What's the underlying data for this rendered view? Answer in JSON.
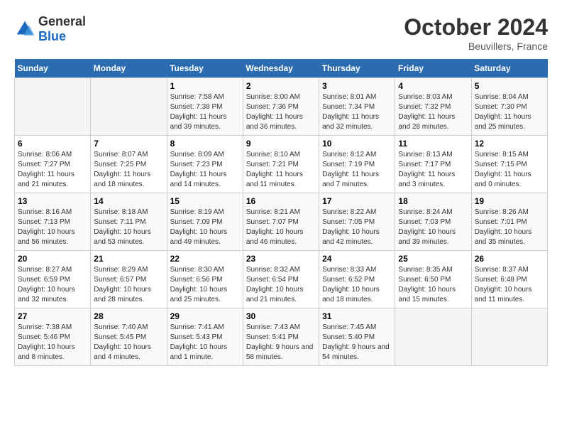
{
  "header": {
    "logo_general": "General",
    "logo_blue": "Blue",
    "month_year": "October 2024",
    "location": "Beuvillers, France"
  },
  "days_of_week": [
    "Sunday",
    "Monday",
    "Tuesday",
    "Wednesday",
    "Thursday",
    "Friday",
    "Saturday"
  ],
  "weeks": [
    [
      {
        "day": "",
        "sunrise": "",
        "sunset": "",
        "daylight": ""
      },
      {
        "day": "",
        "sunrise": "",
        "sunset": "",
        "daylight": ""
      },
      {
        "day": "1",
        "sunrise": "Sunrise: 7:58 AM",
        "sunset": "Sunset: 7:38 PM",
        "daylight": "Daylight: 11 hours and 39 minutes."
      },
      {
        "day": "2",
        "sunrise": "Sunrise: 8:00 AM",
        "sunset": "Sunset: 7:36 PM",
        "daylight": "Daylight: 11 hours and 36 minutes."
      },
      {
        "day": "3",
        "sunrise": "Sunrise: 8:01 AM",
        "sunset": "Sunset: 7:34 PM",
        "daylight": "Daylight: 11 hours and 32 minutes."
      },
      {
        "day": "4",
        "sunrise": "Sunrise: 8:03 AM",
        "sunset": "Sunset: 7:32 PM",
        "daylight": "Daylight: 11 hours and 28 minutes."
      },
      {
        "day": "5",
        "sunrise": "Sunrise: 8:04 AM",
        "sunset": "Sunset: 7:30 PM",
        "daylight": "Daylight: 11 hours and 25 minutes."
      }
    ],
    [
      {
        "day": "6",
        "sunrise": "Sunrise: 8:06 AM",
        "sunset": "Sunset: 7:27 PM",
        "daylight": "Daylight: 11 hours and 21 minutes."
      },
      {
        "day": "7",
        "sunrise": "Sunrise: 8:07 AM",
        "sunset": "Sunset: 7:25 PM",
        "daylight": "Daylight: 11 hours and 18 minutes."
      },
      {
        "day": "8",
        "sunrise": "Sunrise: 8:09 AM",
        "sunset": "Sunset: 7:23 PM",
        "daylight": "Daylight: 11 hours and 14 minutes."
      },
      {
        "day": "9",
        "sunrise": "Sunrise: 8:10 AM",
        "sunset": "Sunset: 7:21 PM",
        "daylight": "Daylight: 11 hours and 11 minutes."
      },
      {
        "day": "10",
        "sunrise": "Sunrise: 8:12 AM",
        "sunset": "Sunset: 7:19 PM",
        "daylight": "Daylight: 11 hours and 7 minutes."
      },
      {
        "day": "11",
        "sunrise": "Sunrise: 8:13 AM",
        "sunset": "Sunset: 7:17 PM",
        "daylight": "Daylight: 11 hours and 3 minutes."
      },
      {
        "day": "12",
        "sunrise": "Sunrise: 8:15 AM",
        "sunset": "Sunset: 7:15 PM",
        "daylight": "Daylight: 11 hours and 0 minutes."
      }
    ],
    [
      {
        "day": "13",
        "sunrise": "Sunrise: 8:16 AM",
        "sunset": "Sunset: 7:13 PM",
        "daylight": "Daylight: 10 hours and 56 minutes."
      },
      {
        "day": "14",
        "sunrise": "Sunrise: 8:18 AM",
        "sunset": "Sunset: 7:11 PM",
        "daylight": "Daylight: 10 hours and 53 minutes."
      },
      {
        "day": "15",
        "sunrise": "Sunrise: 8:19 AM",
        "sunset": "Sunset: 7:09 PM",
        "daylight": "Daylight: 10 hours and 49 minutes."
      },
      {
        "day": "16",
        "sunrise": "Sunrise: 8:21 AM",
        "sunset": "Sunset: 7:07 PM",
        "daylight": "Daylight: 10 hours and 46 minutes."
      },
      {
        "day": "17",
        "sunrise": "Sunrise: 8:22 AM",
        "sunset": "Sunset: 7:05 PM",
        "daylight": "Daylight: 10 hours and 42 minutes."
      },
      {
        "day": "18",
        "sunrise": "Sunrise: 8:24 AM",
        "sunset": "Sunset: 7:03 PM",
        "daylight": "Daylight: 10 hours and 39 minutes."
      },
      {
        "day": "19",
        "sunrise": "Sunrise: 8:26 AM",
        "sunset": "Sunset: 7:01 PM",
        "daylight": "Daylight: 10 hours and 35 minutes."
      }
    ],
    [
      {
        "day": "20",
        "sunrise": "Sunrise: 8:27 AM",
        "sunset": "Sunset: 6:59 PM",
        "daylight": "Daylight: 10 hours and 32 minutes."
      },
      {
        "day": "21",
        "sunrise": "Sunrise: 8:29 AM",
        "sunset": "Sunset: 6:57 PM",
        "daylight": "Daylight: 10 hours and 28 minutes."
      },
      {
        "day": "22",
        "sunrise": "Sunrise: 8:30 AM",
        "sunset": "Sunset: 6:56 PM",
        "daylight": "Daylight: 10 hours and 25 minutes."
      },
      {
        "day": "23",
        "sunrise": "Sunrise: 8:32 AM",
        "sunset": "Sunset: 6:54 PM",
        "daylight": "Daylight: 10 hours and 21 minutes."
      },
      {
        "day": "24",
        "sunrise": "Sunrise: 8:33 AM",
        "sunset": "Sunset: 6:52 PM",
        "daylight": "Daylight: 10 hours and 18 minutes."
      },
      {
        "day": "25",
        "sunrise": "Sunrise: 8:35 AM",
        "sunset": "Sunset: 6:50 PM",
        "daylight": "Daylight: 10 hours and 15 minutes."
      },
      {
        "day": "26",
        "sunrise": "Sunrise: 8:37 AM",
        "sunset": "Sunset: 6:48 PM",
        "daylight": "Daylight: 10 hours and 11 minutes."
      }
    ],
    [
      {
        "day": "27",
        "sunrise": "Sunrise: 7:38 AM",
        "sunset": "Sunset: 5:46 PM",
        "daylight": "Daylight: 10 hours and 8 minutes."
      },
      {
        "day": "28",
        "sunrise": "Sunrise: 7:40 AM",
        "sunset": "Sunset: 5:45 PM",
        "daylight": "Daylight: 10 hours and 4 minutes."
      },
      {
        "day": "29",
        "sunrise": "Sunrise: 7:41 AM",
        "sunset": "Sunset: 5:43 PM",
        "daylight": "Daylight: 10 hours and 1 minute."
      },
      {
        "day": "30",
        "sunrise": "Sunrise: 7:43 AM",
        "sunset": "Sunset: 5:41 PM",
        "daylight": "Daylight: 9 hours and 58 minutes."
      },
      {
        "day": "31",
        "sunrise": "Sunrise: 7:45 AM",
        "sunset": "Sunset: 5:40 PM",
        "daylight": "Daylight: 9 hours and 54 minutes."
      },
      {
        "day": "",
        "sunrise": "",
        "sunset": "",
        "daylight": ""
      },
      {
        "day": "",
        "sunrise": "",
        "sunset": "",
        "daylight": ""
      }
    ]
  ]
}
